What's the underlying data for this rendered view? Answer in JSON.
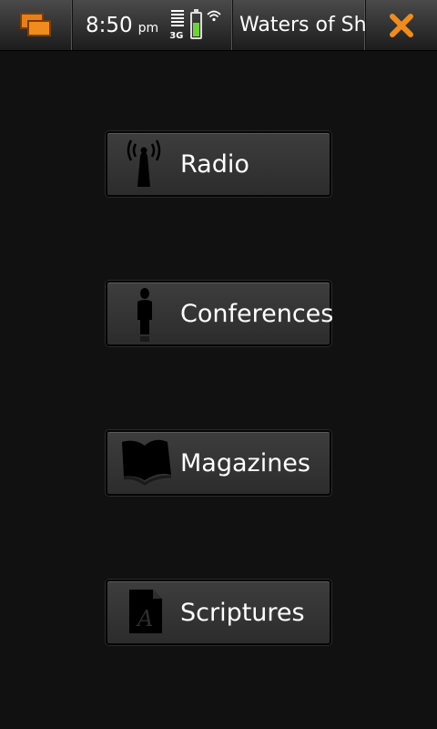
{
  "statusbar": {
    "time": "8:50",
    "ampm": "pm",
    "network": "3G",
    "battery_level": 0.55,
    "app_title": "Waters of Shil",
    "icons": {
      "switcher": "task-switcher-icon",
      "signal": "signal-strength-icon",
      "battery": "battery-icon",
      "wifi": "wifi-icon",
      "close": "close-icon"
    },
    "accent_color": "#f08c1e"
  },
  "menu": [
    {
      "label": "Radio",
      "icon": "radio-tower-icon"
    },
    {
      "label": "Conferences",
      "icon": "person-icon"
    },
    {
      "label": "Magazines",
      "icon": "open-book-icon"
    },
    {
      "label": "Scriptures",
      "icon": "document-icon"
    }
  ]
}
